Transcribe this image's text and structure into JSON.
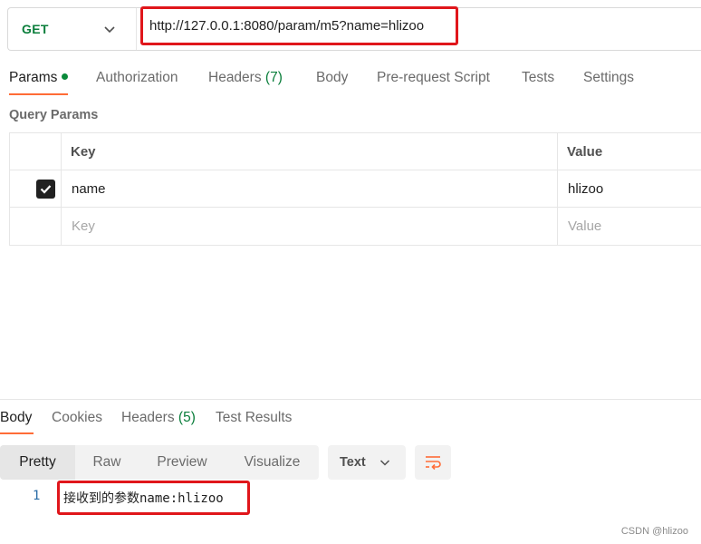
{
  "request": {
    "method": "GET",
    "url": "http://127.0.0.1:8080/param/m5?name=hlizoo"
  },
  "request_tabs": [
    {
      "label": "Params",
      "count": "",
      "active": true,
      "has_dot": true
    },
    {
      "label": "Authorization",
      "count": "",
      "active": false
    },
    {
      "label": "Headers",
      "count": "(7)",
      "active": false
    },
    {
      "label": "Body",
      "count": "",
      "active": false
    },
    {
      "label": "Pre-request Script",
      "count": "",
      "active": false
    },
    {
      "label": "Tests",
      "count": "",
      "active": false
    },
    {
      "label": "Settings",
      "count": "",
      "active": false
    }
  ],
  "query_params": {
    "title": "Query Params",
    "headers": {
      "key": "Key",
      "value": "Value"
    },
    "rows": [
      {
        "checked": true,
        "key": "name",
        "value": "hlizoo"
      }
    ],
    "placeholder": {
      "key": "Key",
      "value": "Value"
    }
  },
  "response_tabs": [
    {
      "label": "Body",
      "count": "",
      "active": true
    },
    {
      "label": "Cookies",
      "count": "",
      "active": false
    },
    {
      "label": "Headers",
      "count": "(5)",
      "active": false
    },
    {
      "label": "Test Results",
      "count": "",
      "active": false
    }
  ],
  "view_modes": [
    {
      "label": "Pretty",
      "active": true
    },
    {
      "label": "Raw",
      "active": false
    },
    {
      "label": "Preview",
      "active": false
    },
    {
      "label": "Visualize",
      "active": false
    }
  ],
  "format": {
    "selected": "Text"
  },
  "response_body": {
    "line_number": "1",
    "text": "接收到的参数name:hlizoo"
  },
  "watermark": "CSDN @hlizoo",
  "colors": {
    "accent": "#ff6c37",
    "method_get": "#0a7e3b",
    "highlight_box": "#e0161b"
  },
  "icons": [
    "chevron-down-icon",
    "check-icon",
    "wrap-lines-icon"
  ]
}
